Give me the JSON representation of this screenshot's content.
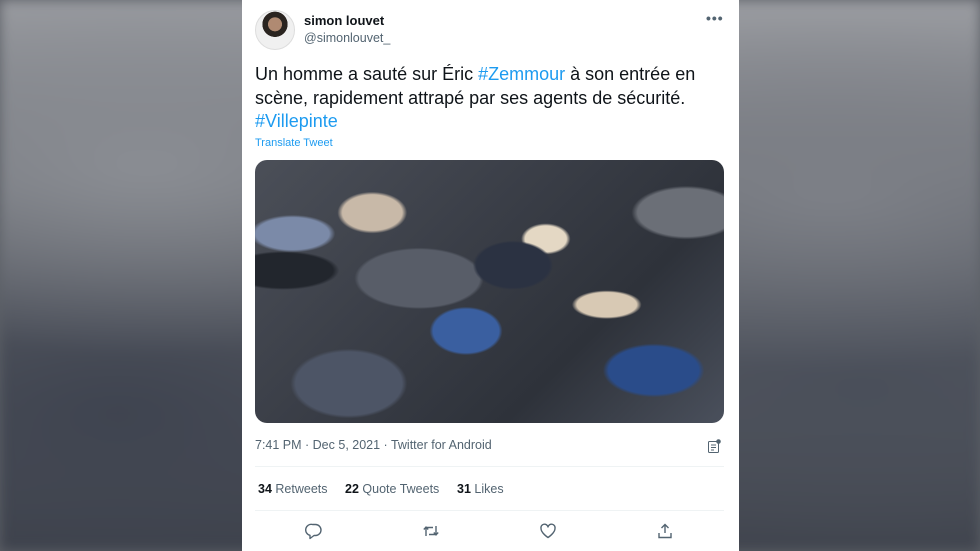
{
  "user": {
    "name": "simon louvet",
    "handle": "@simonlouvet_"
  },
  "tweet": {
    "text_1": "Un homme a sauté sur Éric ",
    "tag_1": "#Zemmour",
    "text_2": " à son entrée en scène, rapidement attrapé par ses agents de sécurité. ",
    "tag_2": "#Villepinte",
    "translate_label": "Translate Tweet",
    "meta": "7:41 PM · Dec 5, 2021 · Twitter for Android"
  },
  "stats": {
    "retweets_count": "34",
    "retweets_label": "Retweets",
    "quotes_count": "22",
    "quotes_label": "Quote Tweets",
    "likes_count": "31",
    "likes_label": "Likes"
  },
  "icons": {
    "more": "more-icon",
    "analytics": "analytics-icon",
    "reply": "reply-icon",
    "retweet": "retweet-icon",
    "like": "like-icon",
    "share": "share-icon"
  },
  "colors": {
    "accent": "#1d9bf0",
    "text": "#0f1419",
    "secondary": "#536471"
  }
}
